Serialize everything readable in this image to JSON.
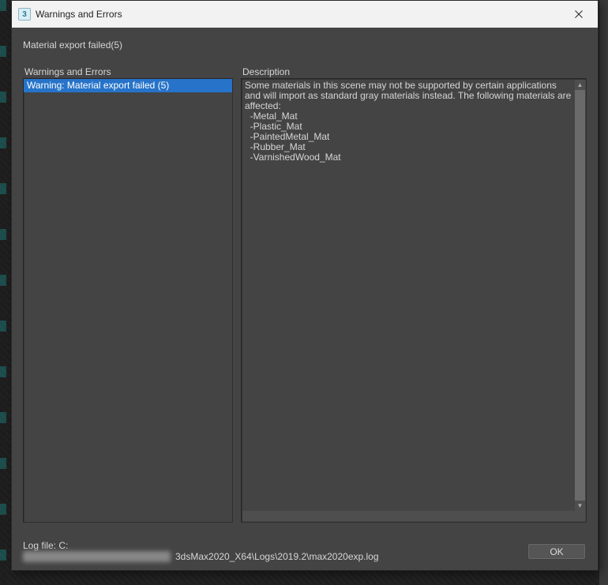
{
  "window": {
    "app_icon_text": "3",
    "title": "Warnings and Errors"
  },
  "summary": "Material export failed(5)",
  "panels": {
    "left_header": "Warnings and Errors",
    "right_header": "Description"
  },
  "warnings_list": [
    {
      "label": "Warning: Material export failed (5)",
      "selected": true
    }
  ],
  "description": "Some materials in this scene may not be supported by certain applications and will import as standard gray materials instead. The following materials are affected:\n  -Metal_Mat\n  -Plastic_Mat\n  -PaintedMetal_Mat\n  -Rubber_Mat\n  -VarnishedWood_Mat",
  "log": {
    "label": "Log file: C:",
    "path_suffix": "3dsMax2020_X64\\Logs\\2019.2\\max2020exp.log"
  },
  "ok_button": "OK"
}
